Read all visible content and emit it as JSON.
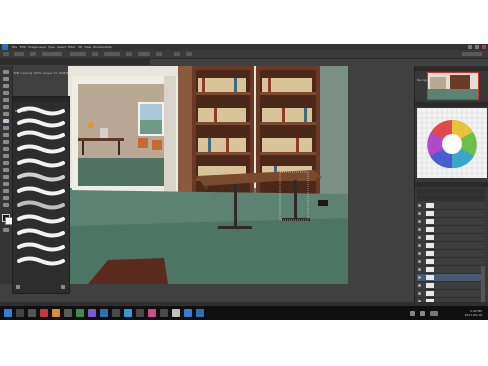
{
  "menu": {
    "items": [
      "File",
      "Edit",
      "Image",
      "Layer",
      "Type",
      "Select",
      "Filter",
      "3D",
      "View",
      "Window",
      "Help"
    ]
  },
  "document": {
    "tab_label": "LOCATION 1.psd @ 100% (Layer 17, RGB/8)"
  },
  "brushes_panel": {
    "title": "Brushes"
  },
  "navigator_panel": {
    "title": "Navigator"
  },
  "swatches_panel": {
    "title": "Swatches"
  },
  "layers_panel": {
    "title": "Layers",
    "layers": [
      "",
      "",
      "",
      "",
      "",
      "",
      "",
      "",
      "",
      "",
      "",
      "",
      "",
      "",
      "",
      "",
      "",
      "",
      "",
      "",
      "",
      ""
    ]
  },
  "status": {
    "zoom": "100%"
  },
  "taskbar": {
    "time": "3:44 PM",
    "date": "2017-09-19"
  },
  "colors": {
    "accent": "#4a5a70",
    "wall_green": "#5f8573",
    "shelf_brown": "#6b3a25",
    "table_brown": "#7a4a2c"
  }
}
